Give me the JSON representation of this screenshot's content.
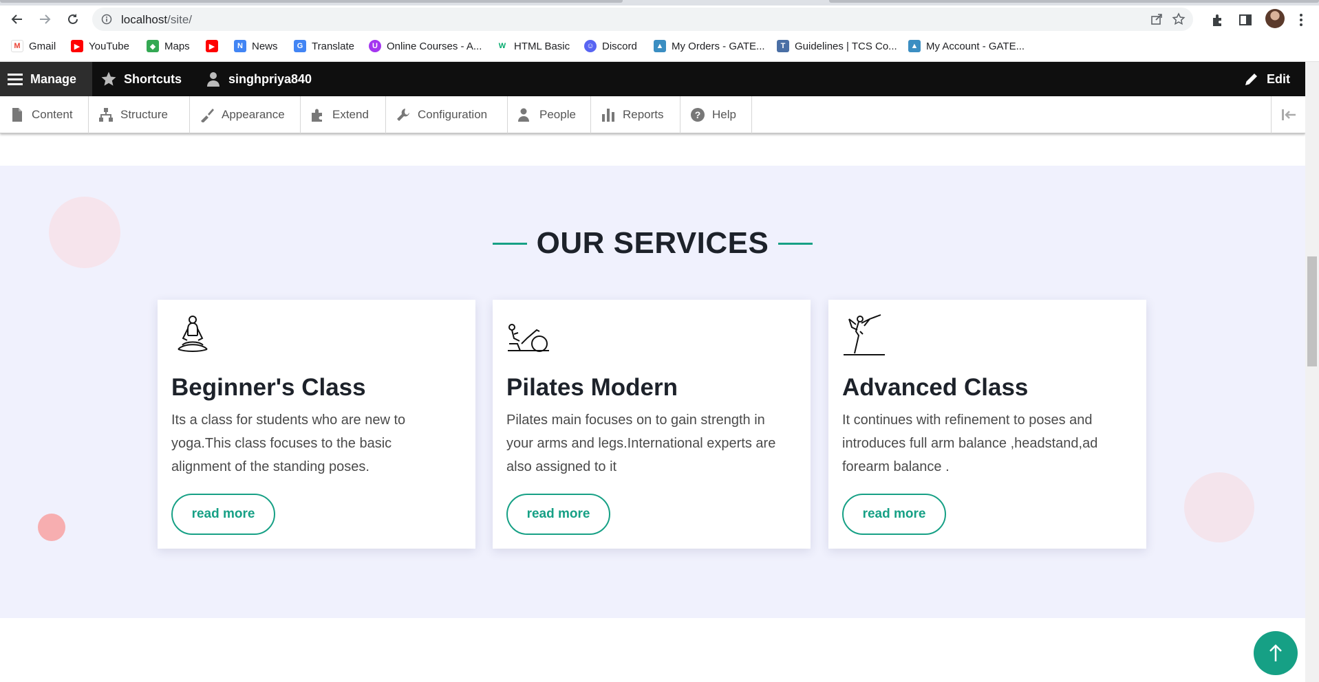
{
  "browser": {
    "url_host": "localhost",
    "url_path": "/site/",
    "bookmarks": [
      {
        "label": "Gmail",
        "icon": "gmail-icon",
        "color": "#ea4335"
      },
      {
        "label": "YouTube",
        "icon": "youtube-icon",
        "color": "#ff0000"
      },
      {
        "label": "Maps",
        "icon": "maps-icon",
        "color": "#34a853"
      },
      {
        "label": "",
        "icon": "youtube-icon",
        "color": "#ff0000"
      },
      {
        "label": "News",
        "icon": "news-icon",
        "color": "#4285f4"
      },
      {
        "label": "Translate",
        "icon": "translate-icon",
        "color": "#4285f4"
      },
      {
        "label": "Online Courses - A...",
        "icon": "udemy-icon",
        "color": "#a435f0"
      },
      {
        "label": "HTML Basic",
        "icon": "w3schools-icon",
        "color": "#04aa6d"
      },
      {
        "label": "Discord",
        "icon": "discord-icon",
        "color": "#5865f2"
      },
      {
        "label": "My Orders - GATE...",
        "icon": "gate-icon",
        "color": "#3b8ec2"
      },
      {
        "label": "Guidelines | TCS Co...",
        "icon": "tcs-icon",
        "color": "#4a6fa5"
      },
      {
        "label": "My Account - GATE...",
        "icon": "gate-icon",
        "color": "#3b8ec2"
      }
    ]
  },
  "admin": {
    "manage": "Manage",
    "shortcuts": "Shortcuts",
    "user": "singhpriya840",
    "edit": "Edit",
    "tray": [
      "Content",
      "Structure",
      "Appearance",
      "Extend",
      "Configuration",
      "People",
      "Reports",
      "Help"
    ]
  },
  "services": {
    "title": "OUR SERVICES",
    "accent": "#16a085",
    "cards": [
      {
        "icon": "meditation-icon",
        "title": "Beginner's Class",
        "lines": [
          "Its a class for students who are new to",
          "yoga.This class focuses to the basic",
          "alignment of the standing poses."
        ],
        "button": "read more"
      },
      {
        "icon": "pilates-ball-icon",
        "title": "Pilates Modern",
        "lines": [
          "Pilates main focuses on to gain strength in",
          "your arms and legs.International experts are",
          "also assigned to it"
        ],
        "button": "read more"
      },
      {
        "icon": "yoga-pose-icon",
        "title": "Advanced Class",
        "lines": [
          "It continues with refinement to poses and",
          "introduces full arm balance ,headstand,ad",
          "forearm balance ."
        ],
        "button": "read more"
      }
    ]
  },
  "back_to_top": "↑"
}
